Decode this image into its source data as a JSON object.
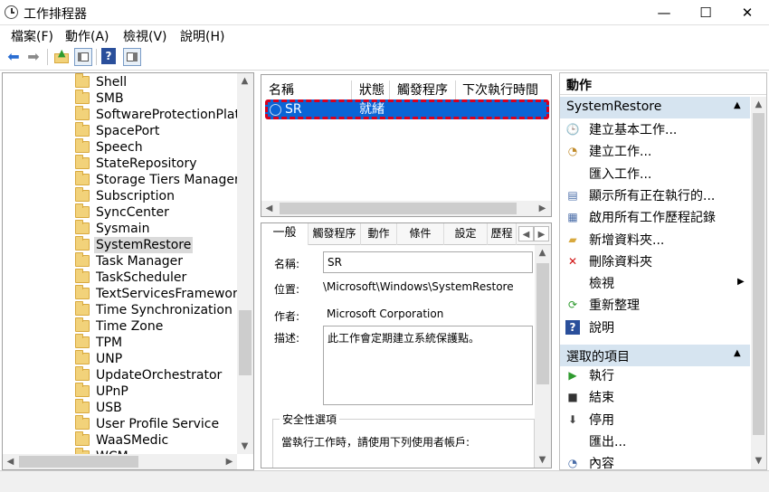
{
  "window": {
    "title": "工作排程器",
    "minimize": "—",
    "maximize": "☐",
    "close": "✕"
  },
  "menu": [
    "檔案(F)",
    "動作(A)",
    "檢視(V)",
    "說明(H)"
  ],
  "toolbar": {
    "icons": [
      "back-icon",
      "forward-icon",
      "up-folder-icon",
      "show-hide-tree-icon",
      "help-icon",
      "show-hide-action-icon"
    ]
  },
  "tree": {
    "items": [
      "Shell",
      "SMB",
      "SoftwareProtectionPlatfo",
      "SpacePort",
      "Speech",
      "StateRepository",
      "Storage Tiers Managem",
      "Subscription",
      "SyncCenter",
      "Sysmain",
      "SystemRestore",
      "Task Manager",
      "TaskScheduler",
      "TextServicesFramework",
      "Time Synchronization",
      "Time Zone",
      "TPM",
      "UNP",
      "UpdateOrchestrator",
      "UPnP",
      "USB",
      "User Profile Service",
      "WaaSMedic",
      "WCM"
    ],
    "selected": "SystemRestore"
  },
  "tasklist": {
    "columns": [
      "名稱",
      "狀態",
      "觸發程序",
      "下次執行時間"
    ],
    "rows": [
      {
        "name": "SR",
        "status": "就緒"
      }
    ]
  },
  "detail": {
    "tabs": [
      "一般",
      "觸發程序",
      "動作",
      "條件",
      "設定",
      "歷程"
    ],
    "name_label": "名稱:",
    "name_value": "SR",
    "location_label": "位置:",
    "location_value": "\\Microsoft\\Windows\\SystemRestore",
    "author_label": "作者:",
    "author_value": "Microsoft Corporation",
    "desc_label": "描述:",
    "desc_value": "此工作會定期建立系統保護點。",
    "security_title": "安全性選項",
    "security_text": "當執行工作時，請使用下列使用者帳戶:"
  },
  "actions": {
    "header": "動作",
    "section1": "SystemRestore",
    "items1": [
      {
        "icon": "create-basic-task-icon",
        "label": "建立基本工作..."
      },
      {
        "icon": "create-task-icon",
        "label": "建立工作..."
      },
      {
        "icon": "",
        "label": "匯入工作..."
      },
      {
        "icon": "running-tasks-icon",
        "label": "顯示所有正在執行的..."
      },
      {
        "icon": "history-icon",
        "label": "啟用所有工作歷程記錄"
      },
      {
        "icon": "new-folder-icon",
        "label": "新增資料夾..."
      },
      {
        "icon": "delete-icon",
        "label": "刪除資料夾"
      },
      {
        "icon": "",
        "label": "檢視"
      },
      {
        "icon": "refresh-icon",
        "label": "重新整理"
      },
      {
        "icon": "help-icon",
        "label": "說明"
      }
    ],
    "section2": "選取的項目",
    "items2": [
      {
        "icon": "run-icon",
        "label": "執行"
      },
      {
        "icon": "end-icon",
        "label": "結束"
      },
      {
        "icon": "disable-icon",
        "label": "停用"
      },
      {
        "icon": "",
        "label": "匯出..."
      },
      {
        "icon": "properties-icon",
        "label": "內容"
      }
    ]
  }
}
